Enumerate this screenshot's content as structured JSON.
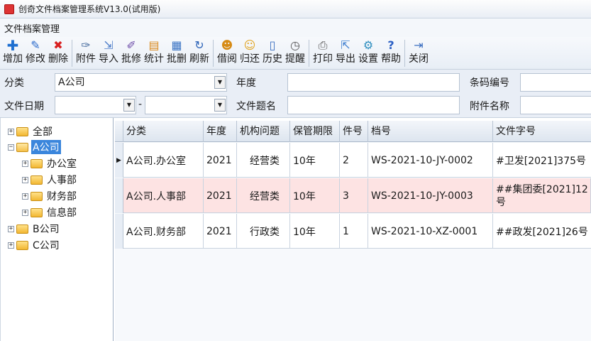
{
  "window": {
    "title": "创奇文件档案管理系统V13.0(试用版)"
  },
  "menu": {
    "title": "文件档案管理"
  },
  "toolbar": {
    "add": "增加",
    "edit": "修改",
    "delete": "删除",
    "attach": "附件",
    "import": "导入",
    "batch_edit": "批修",
    "stats": "统计",
    "batch_delete": "批删",
    "refresh": "刷新",
    "borrow": "借阅",
    "return": "归还",
    "history": "历史",
    "remind": "提醒",
    "print": "打印",
    "export": "导出",
    "settings": "设置",
    "help": "帮助",
    "close": "关闭"
  },
  "filters": {
    "category_label": "分类",
    "category_value": "A公司",
    "year_label": "年度",
    "year_value": "",
    "barcode_label": "条码编号",
    "barcode_value": "",
    "date_label": "文件日期",
    "date_from": "",
    "date_sep": "-",
    "date_to": "",
    "doc_title_label": "文件题名",
    "doc_title_value": "",
    "attachment_label": "附件名称",
    "attachment_value": ""
  },
  "tree": {
    "all": "全部",
    "company_a": "A公司",
    "office": "办公室",
    "hr": "人事部",
    "finance": "财务部",
    "info": "信息部",
    "company_b": "B公司",
    "company_c": "C公司"
  },
  "table": {
    "headers": [
      "分类",
      "年度",
      "机构问题",
      "保管期限",
      "件号",
      "档号",
      "文件字号"
    ],
    "rows": [
      [
        "A公司.办公室",
        "2021",
        "经营类",
        "10年",
        "2",
        "WS-2021-10-JY-0002",
        "#卫发[2021]375号"
      ],
      [
        "A公司.人事部",
        "2021",
        "经营类",
        "10年",
        "3",
        "WS-2021-10-JY-0003",
        "##集团委[2021]12号"
      ],
      [
        "A公司.财务部",
        "2021",
        "行政类",
        "10年",
        "1",
        "WS-2021-10-XZ-0001",
        "##政发[2021]26号"
      ]
    ]
  },
  "colors": {
    "selected_row": "#fde3e3",
    "tree_selected": "#3b86dc"
  }
}
